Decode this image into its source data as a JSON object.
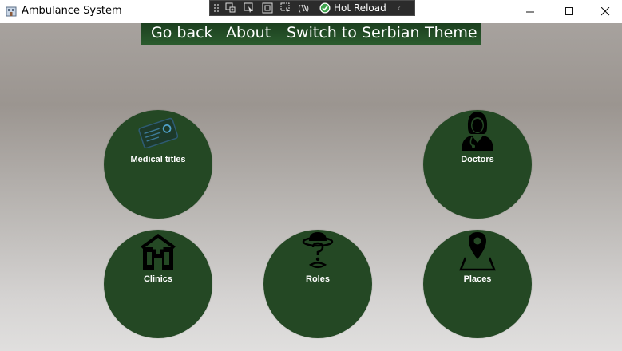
{
  "window": {
    "title": "Ambulance System",
    "controls": {
      "minimize": "—",
      "maximize": "☐",
      "close": "✕"
    }
  },
  "dev_toolbar": {
    "hot_reload_label": "Hot Reload",
    "icons": [
      "live-visual-tree-icon",
      "select-element-icon",
      "display-layout-adorners-icon",
      "track-focused-element-icon",
      "binding-failures-icon"
    ]
  },
  "menu": {
    "items": [
      {
        "label": "Go back"
      },
      {
        "label": "About"
      },
      {
        "label": "Switch to Serbian"
      },
      {
        "label": "Theme"
      }
    ]
  },
  "tiles": [
    {
      "label": "Medical titles",
      "icon": "id-card-icon"
    },
    {
      "label": "Doctors",
      "icon": "doctor-icon"
    },
    {
      "label": "Clinics",
      "icon": "hospital-icon"
    },
    {
      "label": "Roles",
      "icon": "fedora-hat-icon"
    },
    {
      "label": "Places",
      "icon": "map-pin-icon"
    }
  ],
  "colors": {
    "tile_green": "#244824",
    "menu_green": "#2a5a2d",
    "hot_reload_check": "#2ea043"
  }
}
